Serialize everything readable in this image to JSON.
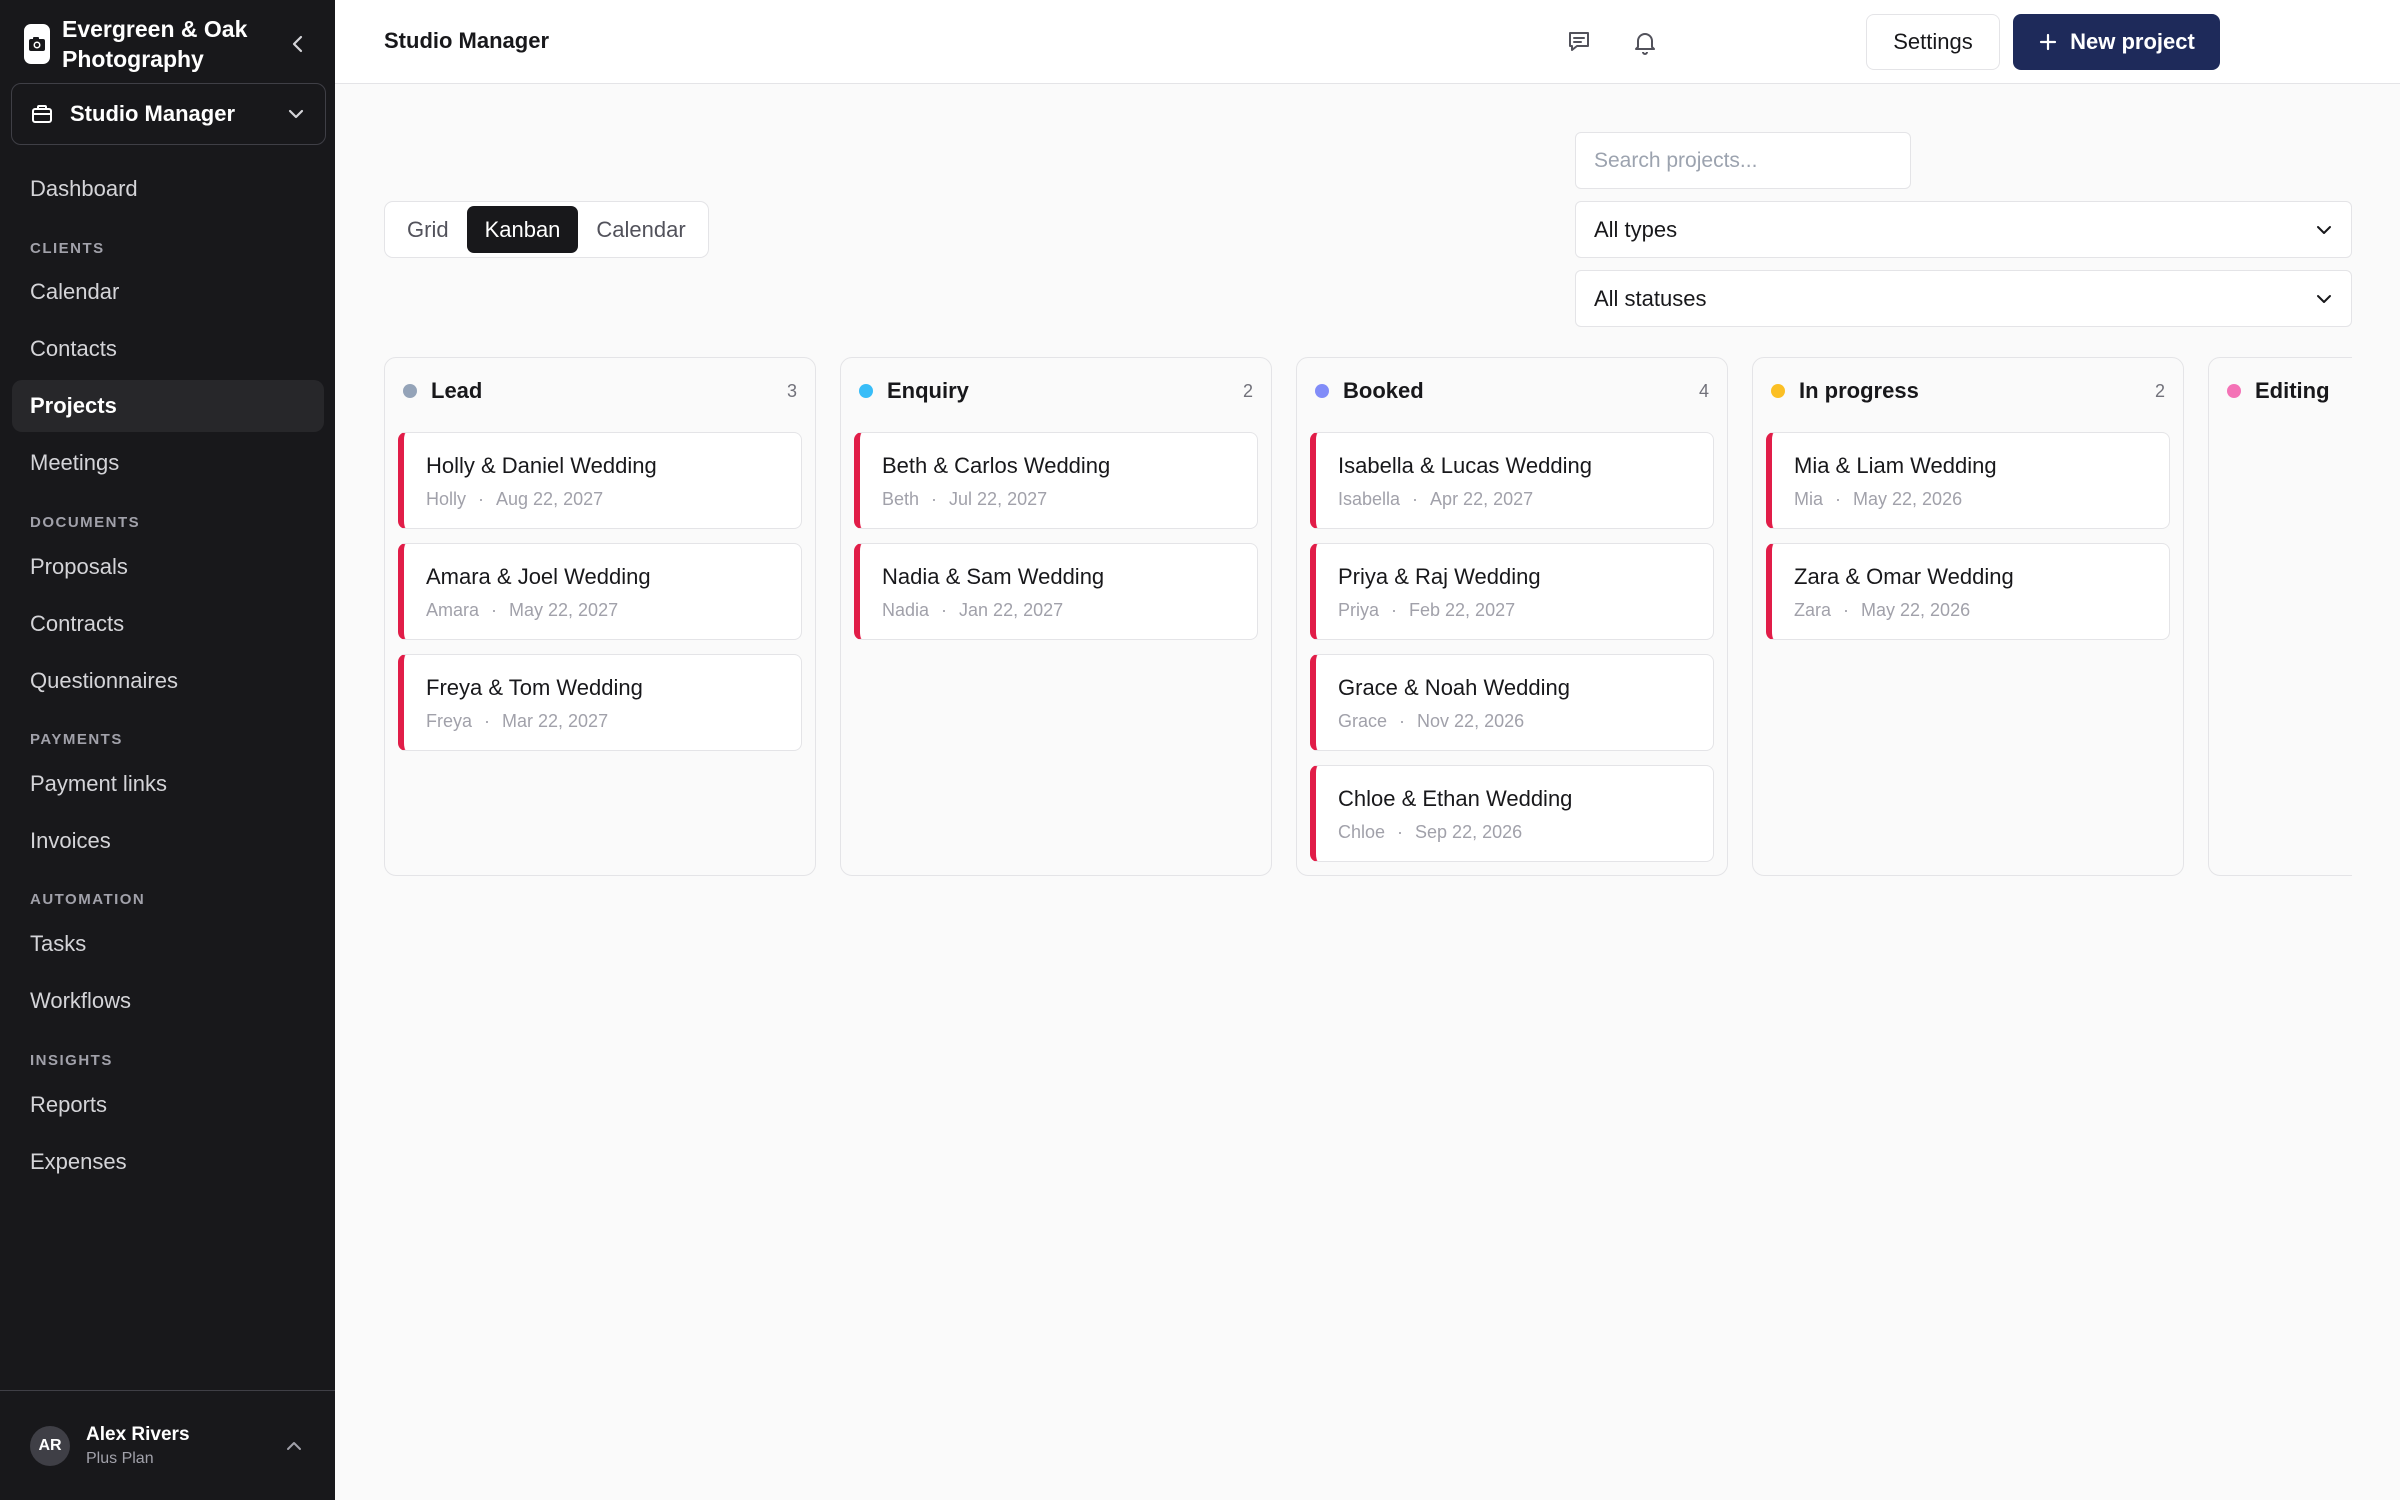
{
  "sidebar": {
    "brand": "Evergreen & Oak Photography",
    "workspace": "Studio Manager",
    "items": [
      {
        "label": "Dashboard"
      },
      {
        "section": "CLIENTS"
      },
      {
        "label": "Calendar"
      },
      {
        "label": "Contacts"
      },
      {
        "label": "Projects",
        "active": true
      },
      {
        "label": "Meetings"
      },
      {
        "section": "DOCUMENTS"
      },
      {
        "label": "Proposals"
      },
      {
        "label": "Contracts"
      },
      {
        "label": "Questionnaires"
      },
      {
        "section": "PAYMENTS"
      },
      {
        "label": "Payment links"
      },
      {
        "label": "Invoices"
      },
      {
        "section": "AUTOMATION"
      },
      {
        "label": "Tasks"
      },
      {
        "label": "Workflows"
      },
      {
        "section": "INSIGHTS"
      },
      {
        "label": "Reports"
      },
      {
        "label": "Expenses"
      }
    ],
    "user": {
      "initials": "AR",
      "name": "Alex Rivers",
      "plan": "Plus Plan"
    }
  },
  "topbar": {
    "title": "Studio Manager",
    "settings_label": "Settings",
    "new_project_label": "New project"
  },
  "views": {
    "tabs": [
      "Grid",
      "Kanban",
      "Calendar"
    ],
    "active": "Kanban"
  },
  "filters": {
    "search_placeholder": "Search projects...",
    "type_value": "All types",
    "status_value": "All statuses"
  },
  "kanban": {
    "columns": [
      {
        "title": "Lead",
        "count": "3",
        "color": "#94a3b8",
        "cards": [
          {
            "title": "Holly & Daniel Wedding",
            "client": "Holly",
            "date": "Aug 22, 2027"
          },
          {
            "title": "Amara & Joel Wedding",
            "client": "Amara",
            "date": "May 22, 2027"
          },
          {
            "title": "Freya & Tom Wedding",
            "client": "Freya",
            "date": "Mar 22, 2027"
          }
        ]
      },
      {
        "title": "Enquiry",
        "count": "2",
        "color": "#38bdf8",
        "cards": [
          {
            "title": "Beth & Carlos Wedding",
            "client": "Beth",
            "date": "Jul 22, 2027"
          },
          {
            "title": "Nadia & Sam Wedding",
            "client": "Nadia",
            "date": "Jan 22, 2027"
          }
        ]
      },
      {
        "title": "Booked",
        "count": "4",
        "color": "#818cf8",
        "cards": [
          {
            "title": "Isabella & Lucas Wedding",
            "client": "Isabella",
            "date": "Apr 22, 2027"
          },
          {
            "title": "Priya & Raj Wedding",
            "client": "Priya",
            "date": "Feb 22, 2027"
          },
          {
            "title": "Grace & Noah Wedding",
            "client": "Grace",
            "date": "Nov 22, 2026"
          },
          {
            "title": "Chloe & Ethan Wedding",
            "client": "Chloe",
            "date": "Sep 22, 2026"
          }
        ]
      },
      {
        "title": "In progress",
        "count": "2",
        "color": "#fbbf24",
        "cards": [
          {
            "title": "Mia & Liam Wedding",
            "client": "Mia",
            "date": "May 22, 2026"
          },
          {
            "title": "Zara & Omar Wedding",
            "client": "Zara",
            "date": "May 22, 2026"
          }
        ]
      },
      {
        "title": "Editing",
        "count": "",
        "color": "#f472b6",
        "cards": []
      }
    ]
  }
}
